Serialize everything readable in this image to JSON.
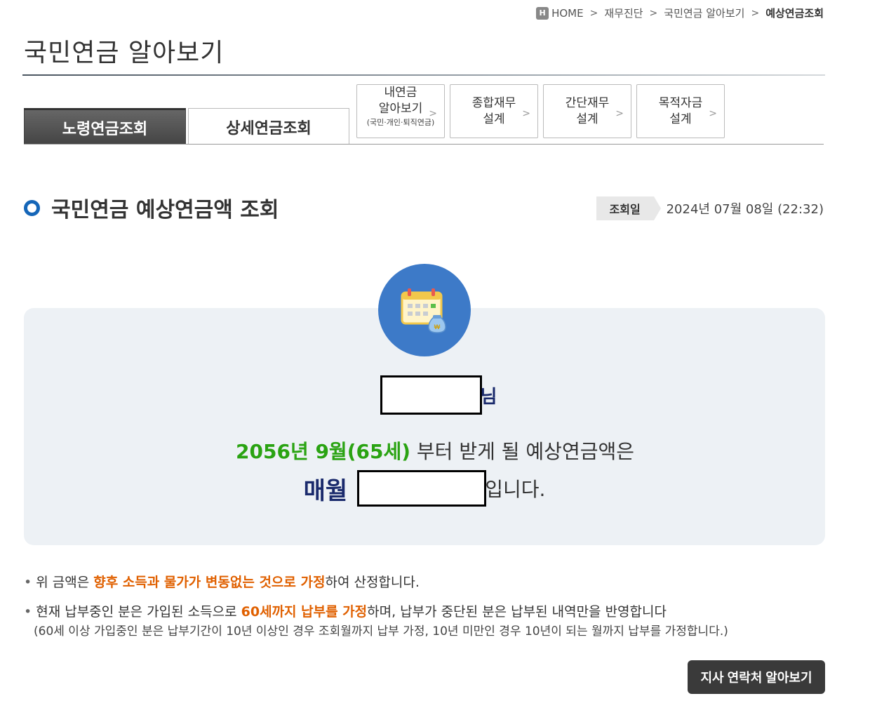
{
  "breadcrumb": {
    "home_icon": "H",
    "home": "HOME",
    "items": [
      "재무진단",
      "국민연금 알아보기"
    ],
    "current": "예상연금조회"
  },
  "page": {
    "title": "국민연금 알아보기"
  },
  "tabs": {
    "active": "노령연금조회",
    "second": "상세연금조회",
    "small": [
      {
        "line1": "내연금",
        "line2": "알아보기",
        "note": "(국민·개인·퇴직연금)"
      },
      {
        "line1": "종합재무",
        "line2": "설계"
      },
      {
        "line1": "간단재무",
        "line2": "설계"
      },
      {
        "line1": "목적자금",
        "line2": "설계"
      }
    ]
  },
  "section": {
    "title": "국민연금 예상연금액 조회",
    "inquiry_label": "조회일",
    "inquiry_date": "2024년 07월 08일 (22:32)"
  },
  "result": {
    "name_suffix": "님",
    "start_highlight": "2056년 9월(65세)",
    "start_rest": " 부터 받게 될 예상연금액은",
    "monthly_label": "매월",
    "amount_suffix": "입니다."
  },
  "notes": {
    "n1_pre": "위 금액은 ",
    "n1_hl": "향후 소득과 물가가 변동없는 것으로 가정",
    "n1_post": "하여 산정합니다.",
    "n2_pre": "현재 납부중인 분은 가입된 소득으로 ",
    "n2_hl": "60세까지 납부를 가정",
    "n2_post": "하며, 납부가 중단된 분은 납부된 내역만을 반영합니다",
    "n2_sub": "(60세 이상 가입중인 분은 납부기간이 10년 이상인 경우 조회월까지 납부 가정, 10년 미만인 경우 10년이 되는 월까지 납부를 가정합니다.)"
  },
  "buttons": {
    "contact": "지사 연락처 알아보기"
  },
  "colors": {
    "accent_blue": "#1566b8",
    "highlight_green": "#2aa312",
    "highlight_orange": "#e06000",
    "navy": "#1a2a6c"
  }
}
